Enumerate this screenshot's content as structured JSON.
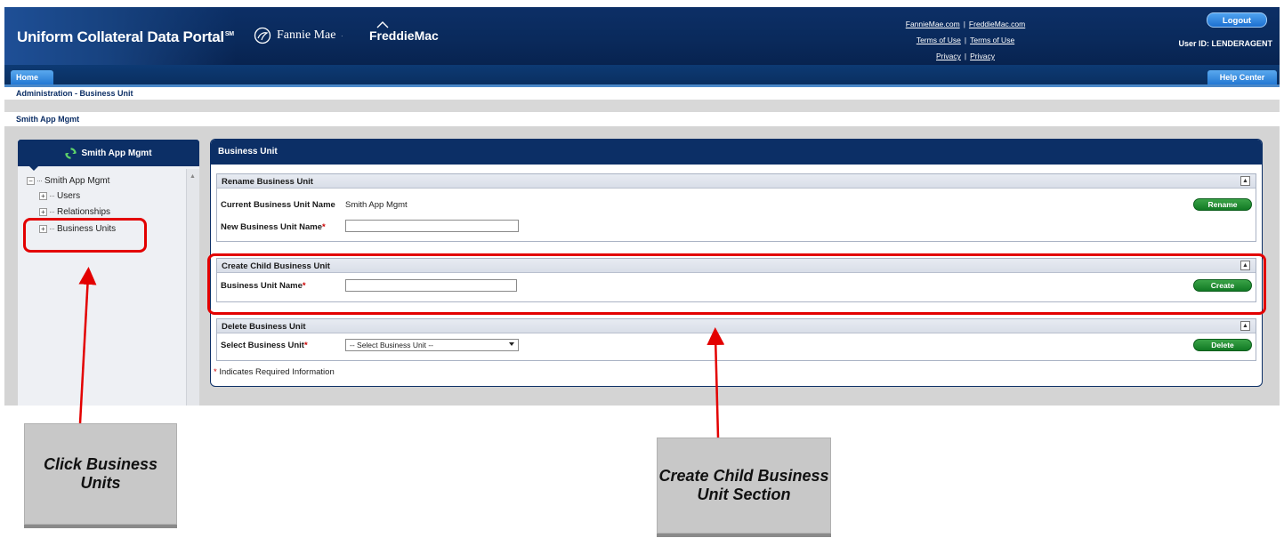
{
  "header": {
    "portal_title": "Uniform Collateral Data Portal",
    "portal_title_mark": "SM",
    "fannie_logo": "Fannie Mae",
    "fannie_mark": ".",
    "freddie_logo": "FreddieMac",
    "links": [
      [
        "FannieMae.com",
        "FreddieMac.com"
      ],
      [
        "Terms of Use",
        "Terms of Use"
      ],
      [
        "Privacy",
        "Privacy"
      ]
    ],
    "link_separator": "|",
    "logout_label": "Logout",
    "user_id": "User ID: LENDERAGENT"
  },
  "nav": {
    "home_tab": "Home",
    "help_center": "Help Center"
  },
  "breadcrumb": "Administration - Business Unit",
  "context_title": "Smith App Mgmt",
  "tree": {
    "header": "Smith App Mgmt",
    "root": "Smith App Mgmt",
    "children": [
      "Users",
      "Relationships",
      "Business Units"
    ],
    "collapse_symbol": "−",
    "expand_symbol": "+"
  },
  "business_unit": {
    "panel_title": "Business Unit",
    "rename": {
      "title": "Rename Business Unit",
      "current_label": "Current Business Unit Name",
      "current_value": "Smith App Mgmt",
      "new_label": "New Business Unit Name",
      "new_value": "",
      "button": "Rename"
    },
    "create": {
      "title": "Create Child Business Unit",
      "name_label": "Business Unit Name",
      "name_value": "",
      "button": "Create"
    },
    "delete": {
      "title": "Delete Business Unit",
      "select_label": "Select Business Unit",
      "select_value": "-- Select Business Unit --",
      "button": "Delete"
    },
    "required_marker": "*",
    "required_note": "Indicates Required Information"
  },
  "annotations": {
    "callout_left": "Click Business Units",
    "callout_right": "Create Child Business Unit Section",
    "annotation_color": "#e30000"
  },
  "colors": {
    "header_navy": "#0c2f66",
    "button_green": "#117a24",
    "logout_blue": "#1c6fd0"
  }
}
